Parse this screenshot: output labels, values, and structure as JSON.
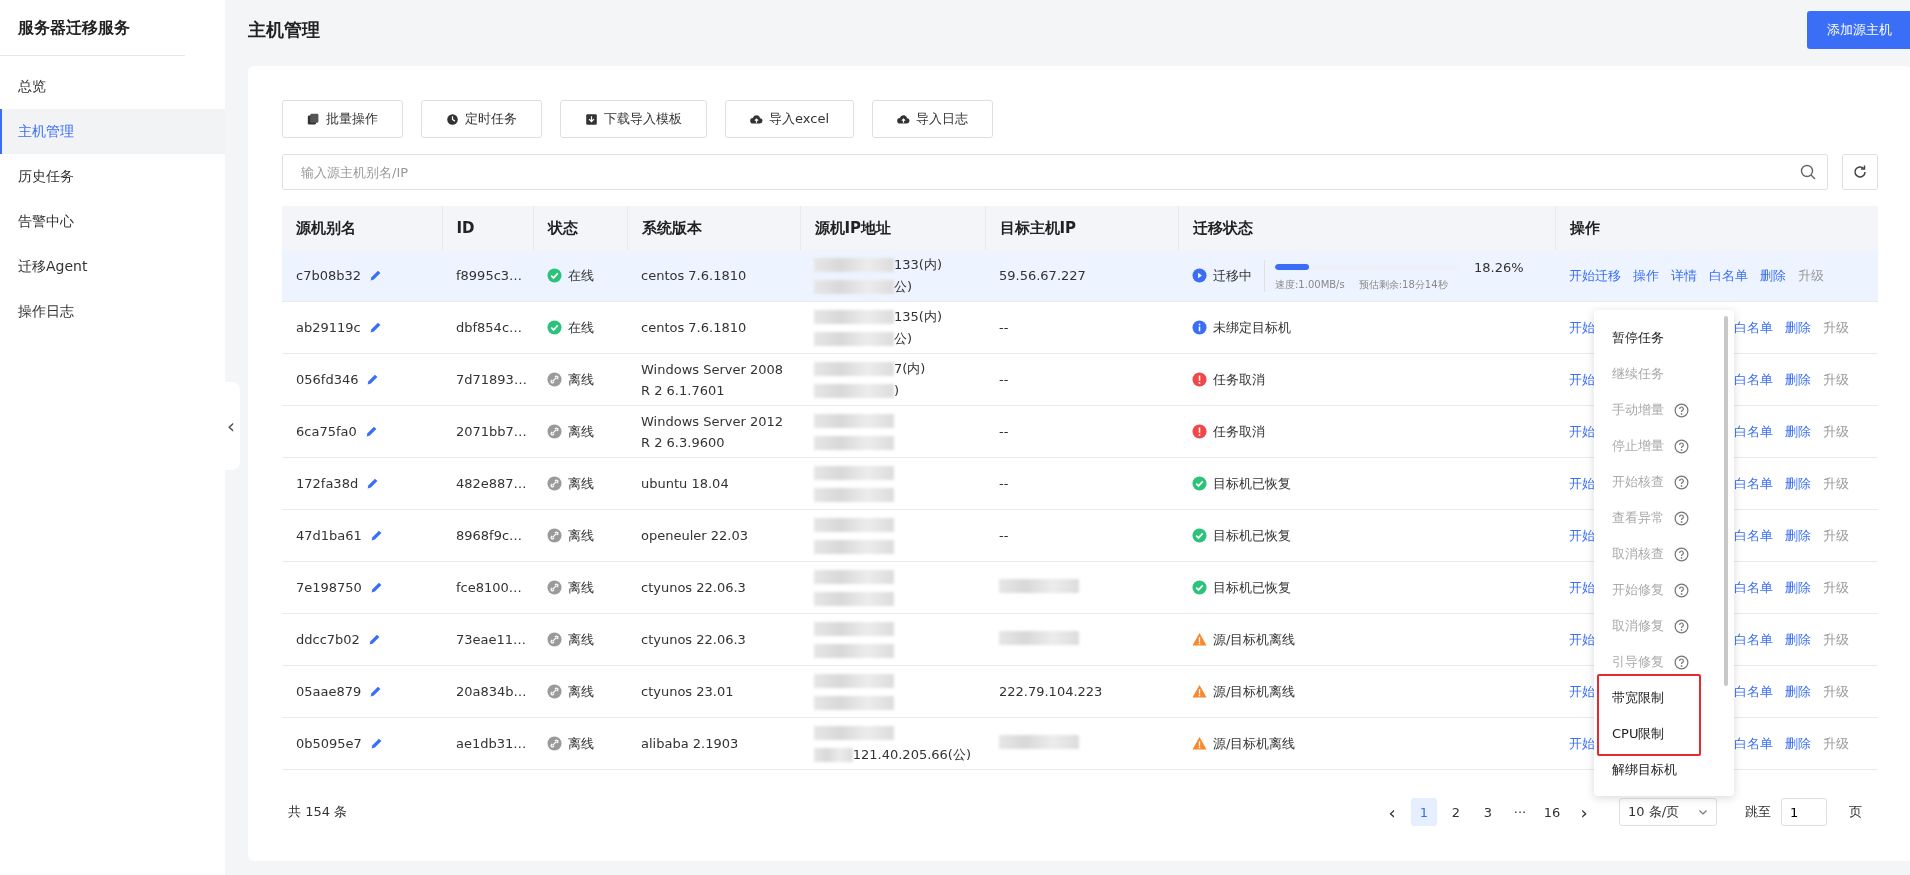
{
  "sidebar": {
    "title": "服务器迁移服务",
    "items": [
      {
        "label": "总览",
        "selected": false
      },
      {
        "label": "主机管理",
        "selected": true
      },
      {
        "label": "历史任务",
        "selected": false
      },
      {
        "label": "告警中心",
        "selected": false
      },
      {
        "label": "迁移Agent",
        "selected": false
      },
      {
        "label": "操作日志",
        "selected": false
      }
    ]
  },
  "collapse_handle": "‹",
  "page_title": "主机管理",
  "add_button": "添加源主机",
  "toolbar": [
    {
      "label": "批量操作",
      "kind": "batch"
    },
    {
      "label": "定时任务",
      "kind": "clock"
    },
    {
      "label": "下载导入模板",
      "kind": "download"
    },
    {
      "label": "导入excel",
      "kind": "upload"
    },
    {
      "label": "导入日志",
      "kind": "upload"
    }
  ],
  "search": {
    "placeholder": "输入源主机别名/IP"
  },
  "table": {
    "columns": [
      "源机别名",
      "ID",
      "状态",
      "系统版本",
      "源机IP地址",
      "目标主机IP",
      "迁移状态",
      "操作"
    ],
    "rows": [
      {
        "alias": "c7b08b32",
        "id": "f8995c3…",
        "online": true,
        "status": "在线",
        "os": "centos 7.6.1810",
        "ip_inner": "133(内)",
        "ip_public": "公)",
        "target_ip": "59.56.67.227",
        "migration": {
          "kind": "running",
          "label": "迁移中",
          "level": 0.1826,
          "percent": "18.26%",
          "speed": "速度:1.00MB/s",
          "remaining": "预估剩余:18分14秒"
        },
        "selected": true,
        "actions": [
          {
            "label": "开始迁移",
            "disabled": false,
            "kind": "link"
          },
          {
            "label": "操作",
            "disabled": false,
            "kind": "link"
          },
          {
            "label": "详情",
            "disabled": false,
            "kind": "link"
          },
          {
            "label": "白名单",
            "disabled": false,
            "kind": "link"
          },
          {
            "label": "删除",
            "disabled": false,
            "kind": "link"
          },
          {
            "label": "升级",
            "disabled": true,
            "kind": "link"
          }
        ]
      },
      {
        "alias": "ab29119c",
        "id": "dbf854c…",
        "online": true,
        "status": "在线",
        "os": "centos 7.6.1810",
        "ip_inner": "135(内)",
        "ip_public": "公)",
        "target_ip": "--",
        "migration": {
          "kind": "info",
          "label": "未绑定目标机"
        },
        "selected": false,
        "actions": [
          {
            "label": "开始",
            "disabled": false,
            "kind": "covered"
          },
          {
            "label": "白名单",
            "disabled": false,
            "kind": "link"
          },
          {
            "label": "删除",
            "disabled": false,
            "kind": "link"
          },
          {
            "label": "升级",
            "disabled": true,
            "kind": "link"
          }
        ]
      },
      {
        "alias": "056fd346",
        "id": "7d71893…",
        "online": false,
        "status": "离线",
        "os": "Windows Server 2008 R 2 6.1.7601",
        "ip_inner": "7(内)",
        "ip_public": ")",
        "target_ip": "--",
        "migration": {
          "kind": "error",
          "label": "任务取消"
        },
        "selected": false,
        "actions": [
          {
            "label": "开始",
            "disabled": false,
            "kind": "covered"
          },
          {
            "label": "白名单",
            "disabled": false,
            "kind": "link"
          },
          {
            "label": "删除",
            "disabled": false,
            "kind": "link"
          },
          {
            "label": "升级",
            "disabled": true,
            "kind": "link"
          }
        ]
      },
      {
        "alias": "6ca75fa0",
        "id": "2071bb7…",
        "online": false,
        "status": "离线",
        "os": "Windows Server 2012 R 2 6.3.9600",
        "target_ip": "--",
        "migration": {
          "kind": "error",
          "label": "任务取消"
        },
        "selected": false,
        "actions": [
          {
            "label": "开始",
            "disabled": false,
            "kind": "covered"
          },
          {
            "label": "白名单",
            "disabled": false,
            "kind": "link"
          },
          {
            "label": "删除",
            "disabled": false,
            "kind": "link"
          },
          {
            "label": "升级",
            "disabled": true,
            "kind": "link"
          }
        ]
      },
      {
        "alias": "172fa38d",
        "id": "482e887…",
        "online": false,
        "status": "离线",
        "os": "ubuntu 18.04",
        "target_ip": "--",
        "migration": {
          "kind": "success",
          "label": "目标机已恢复"
        },
        "selected": false,
        "actions": [
          {
            "label": "开始",
            "disabled": false,
            "kind": "covered"
          },
          {
            "label": "白名单",
            "disabled": false,
            "kind": "link"
          },
          {
            "label": "删除",
            "disabled": false,
            "kind": "link"
          },
          {
            "label": "升级",
            "disabled": true,
            "kind": "link"
          }
        ]
      },
      {
        "alias": "47d1ba61",
        "id": "8968f9c…",
        "online": false,
        "status": "离线",
        "os": "openeuler 22.03",
        "target_ip": "--",
        "migration": {
          "kind": "success",
          "label": "目标机已恢复"
        },
        "selected": false,
        "actions": [
          {
            "label": "开始",
            "disabled": false,
            "kind": "covered"
          },
          {
            "label": "白名单",
            "disabled": false,
            "kind": "link"
          },
          {
            "label": "删除",
            "disabled": false,
            "kind": "link"
          },
          {
            "label": "升级",
            "disabled": true,
            "kind": "link"
          }
        ]
      },
      {
        "alias": "7e198750",
        "id": "fce8100…",
        "online": false,
        "status": "离线",
        "os": "ctyunos 22.06.3",
        "migration": {
          "kind": "success",
          "label": "目标机已恢复"
        },
        "selected": false,
        "actions": [
          {
            "label": "开始",
            "disabled": false,
            "kind": "covered"
          },
          {
            "label": "白名单",
            "disabled": false,
            "kind": "link"
          },
          {
            "label": "删除",
            "disabled": false,
            "kind": "link"
          },
          {
            "label": "升级",
            "disabled": true,
            "kind": "link"
          }
        ]
      },
      {
        "alias": "ddcc7b02",
        "id": "73eae11…",
        "online": false,
        "status": "离线",
        "os": "ctyunos 22.06.3",
        "migration": {
          "kind": "warning",
          "label": "源/目标机离线"
        },
        "selected": false,
        "actions": [
          {
            "label": "开始",
            "disabled": false,
            "kind": "covered"
          },
          {
            "label": "白名单",
            "disabled": false,
            "kind": "link"
          },
          {
            "label": "删除",
            "disabled": false,
            "kind": "link"
          },
          {
            "label": "升级",
            "disabled": true,
            "kind": "link"
          }
        ]
      },
      {
        "alias": "05aae879",
        "id": "20a834b…",
        "online": false,
        "status": "离线",
        "os": "ctyunos 23.01",
        "target_ip": "222.79.104.223",
        "migration": {
          "kind": "warning",
          "label": "源/目标机离线"
        },
        "selected": false,
        "actions": [
          {
            "label": "开始",
            "disabled": false,
            "kind": "covered"
          },
          {
            "label": "白名单",
            "disabled": false,
            "kind": "link"
          },
          {
            "label": "删除",
            "disabled": false,
            "kind": "link"
          },
          {
            "label": "升级",
            "disabled": true,
            "kind": "link"
          }
        ]
      },
      {
        "alias": "0b5095e7",
        "id": "ae1db31…",
        "online": false,
        "status": "离线",
        "os": "alibaba 2.1903",
        "ip_public": "121.40.205.66(公)",
        "migration": {
          "kind": "warning",
          "label": "源/目标机离线"
        },
        "selected": false,
        "actions": [
          {
            "label": "开始",
            "disabled": false,
            "kind": "covered"
          },
          {
            "label": "白名单",
            "disabled": false,
            "kind": "link"
          },
          {
            "label": "删除",
            "disabled": false,
            "kind": "link"
          },
          {
            "label": "升级",
            "disabled": true,
            "kind": "link"
          }
        ]
      }
    ]
  },
  "menu": {
    "items": [
      {
        "label": "暂停任务",
        "disabled": false,
        "help": false,
        "highlighted": false
      },
      {
        "label": "继续任务",
        "disabled": true,
        "help": false,
        "highlighted": false
      },
      {
        "label": "手动增量",
        "disabled": true,
        "help": true,
        "highlighted": false
      },
      {
        "label": "停止增量",
        "disabled": true,
        "help": true,
        "highlighted": false
      },
      {
        "label": "开始核查",
        "disabled": true,
        "help": true,
        "highlighted": false
      },
      {
        "label": "查看异常",
        "disabled": true,
        "help": true,
        "highlighted": false
      },
      {
        "label": "取消核查",
        "disabled": true,
        "help": true,
        "highlighted": false
      },
      {
        "label": "开始修复",
        "disabled": true,
        "help": true,
        "highlighted": false
      },
      {
        "label": "取消修复",
        "disabled": true,
        "help": true,
        "highlighted": false
      },
      {
        "label": "引导修复",
        "disabled": true,
        "help": true,
        "highlighted": false
      },
      {
        "label": "带宽限制",
        "disabled": false,
        "help": false,
        "highlighted": true
      },
      {
        "label": "CPU限制",
        "disabled": false,
        "help": false,
        "highlighted": true
      },
      {
        "label": "解绑目标机",
        "disabled": false,
        "help": false,
        "highlighted": false
      }
    ]
  },
  "pagination": {
    "total": "共 154 条",
    "prev": "‹",
    "next": "›",
    "pages": [
      {
        "label": "1",
        "selected": true
      },
      {
        "label": "2",
        "selected": false
      },
      {
        "label": "3",
        "selected": false
      },
      {
        "label": "···",
        "selected": false
      },
      {
        "label": "16",
        "selected": false
      }
    ],
    "page_size": "10 条/页",
    "jump_label": "跳至",
    "jump_value": "1",
    "page_unit": "页"
  }
}
